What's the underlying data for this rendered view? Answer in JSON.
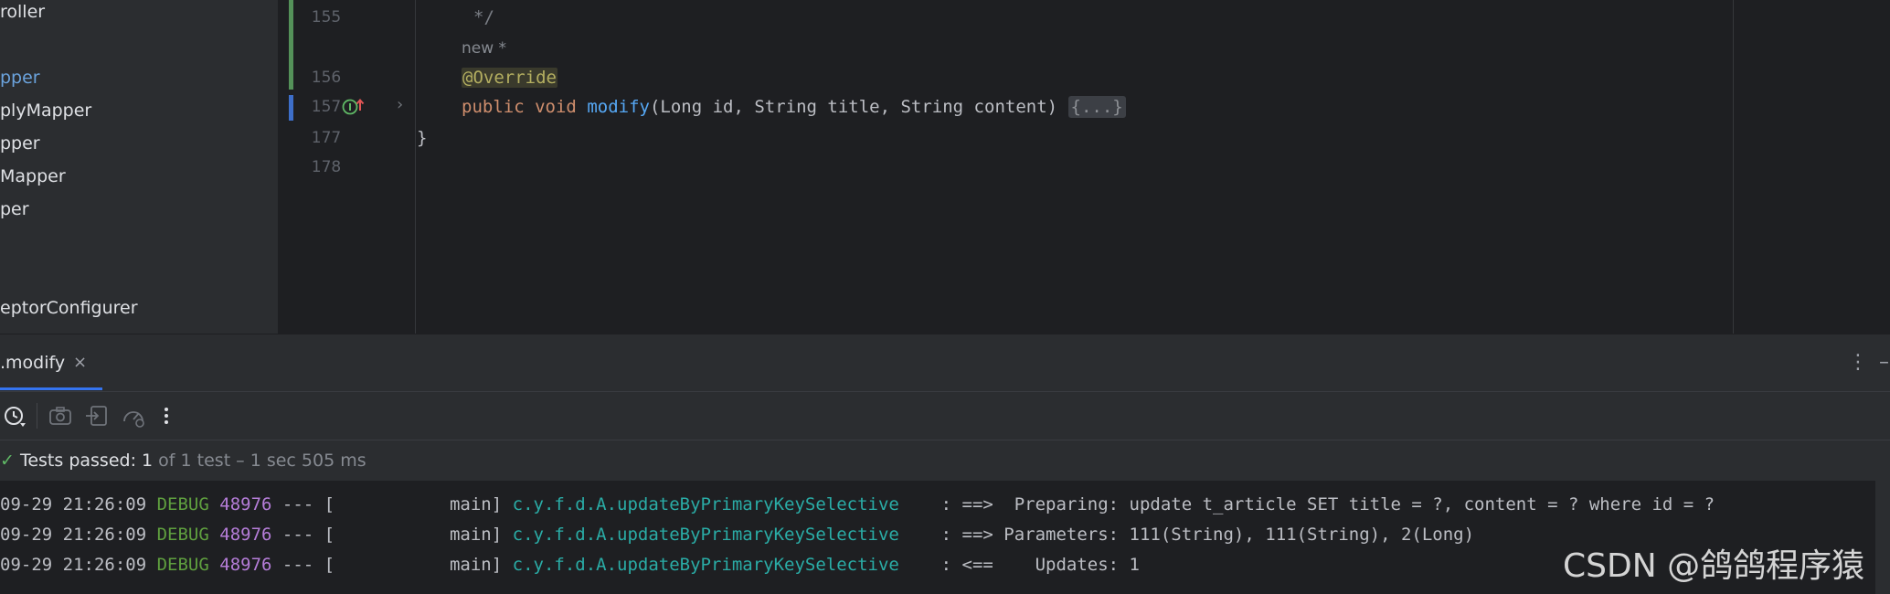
{
  "project_tree": {
    "items": [
      {
        "label": "roller",
        "selected": false
      },
      {
        "label": "pper",
        "selected": true
      },
      {
        "label": "plyMapper",
        "selected": false
      },
      {
        "label": "pper",
        "selected": false
      },
      {
        "label": "Mapper",
        "selected": false
      },
      {
        "label": "per",
        "selected": false
      },
      {
        "label": "eptorConfigurer",
        "selected": false
      }
    ]
  },
  "editor": {
    "line_numbers": [
      "155",
      "156",
      "157",
      "177",
      "178"
    ],
    "comment_close": "*/",
    "inlay_hint": "new *",
    "annotation": "@Override",
    "method": {
      "kw_public": "public",
      "kw_void": "void",
      "name": "modify",
      "params": "(Long id, String title, String content)",
      "folded_body": "{...}"
    },
    "closing_brace": "}",
    "gutter_icons": {
      "implements": "implements-method-icon",
      "fold": "chevron-right-icon"
    }
  },
  "run_panel": {
    "tab_label": ".modify",
    "tab_close": "×",
    "options_icon": "⋮",
    "minimize_icon": "–",
    "toolbar_icons": [
      "history-icon",
      "camera-icon",
      "import-icon",
      "speedometer-icon",
      "more-icon"
    ],
    "status": {
      "check": "✓",
      "label": "Tests passed:",
      "count": "1",
      "detail": "of 1 test – 1 sec 505 ms"
    },
    "console_lines": [
      {
        "time": "09-29 21:26:09",
        "level": "DEBUG",
        "pid": "48976",
        "sep": "--- [",
        "thread": "main]",
        "logger": "c.y.f.d.A.updateByPrimaryKeySelective",
        "message": ": ==>  Preparing: update t_article SET title = ?, content = ? where id = ?"
      },
      {
        "time": "09-29 21:26:09",
        "level": "DEBUG",
        "pid": "48976",
        "sep": "--- [",
        "thread": "main]",
        "logger": "c.y.f.d.A.updateByPrimaryKeySelective",
        "message": ": ==> Parameters: 111(String), 111(String), 2(Long)"
      },
      {
        "time": "09-29 21:26:09",
        "level": "DEBUG",
        "pid": "48976",
        "sep": "--- [",
        "thread": "main]",
        "logger": "c.y.f.d.A.updateByPrimaryKeySelective",
        "message": ": <==    Updates: 1"
      }
    ]
  },
  "watermark": "CSDN @鸽鸽程序猿",
  "colors": {
    "accent": "#3574f0",
    "pass": "#5fb865",
    "debug": "#5f9f3f",
    "pid": "#b57dd8",
    "logger": "#2aaca6"
  }
}
